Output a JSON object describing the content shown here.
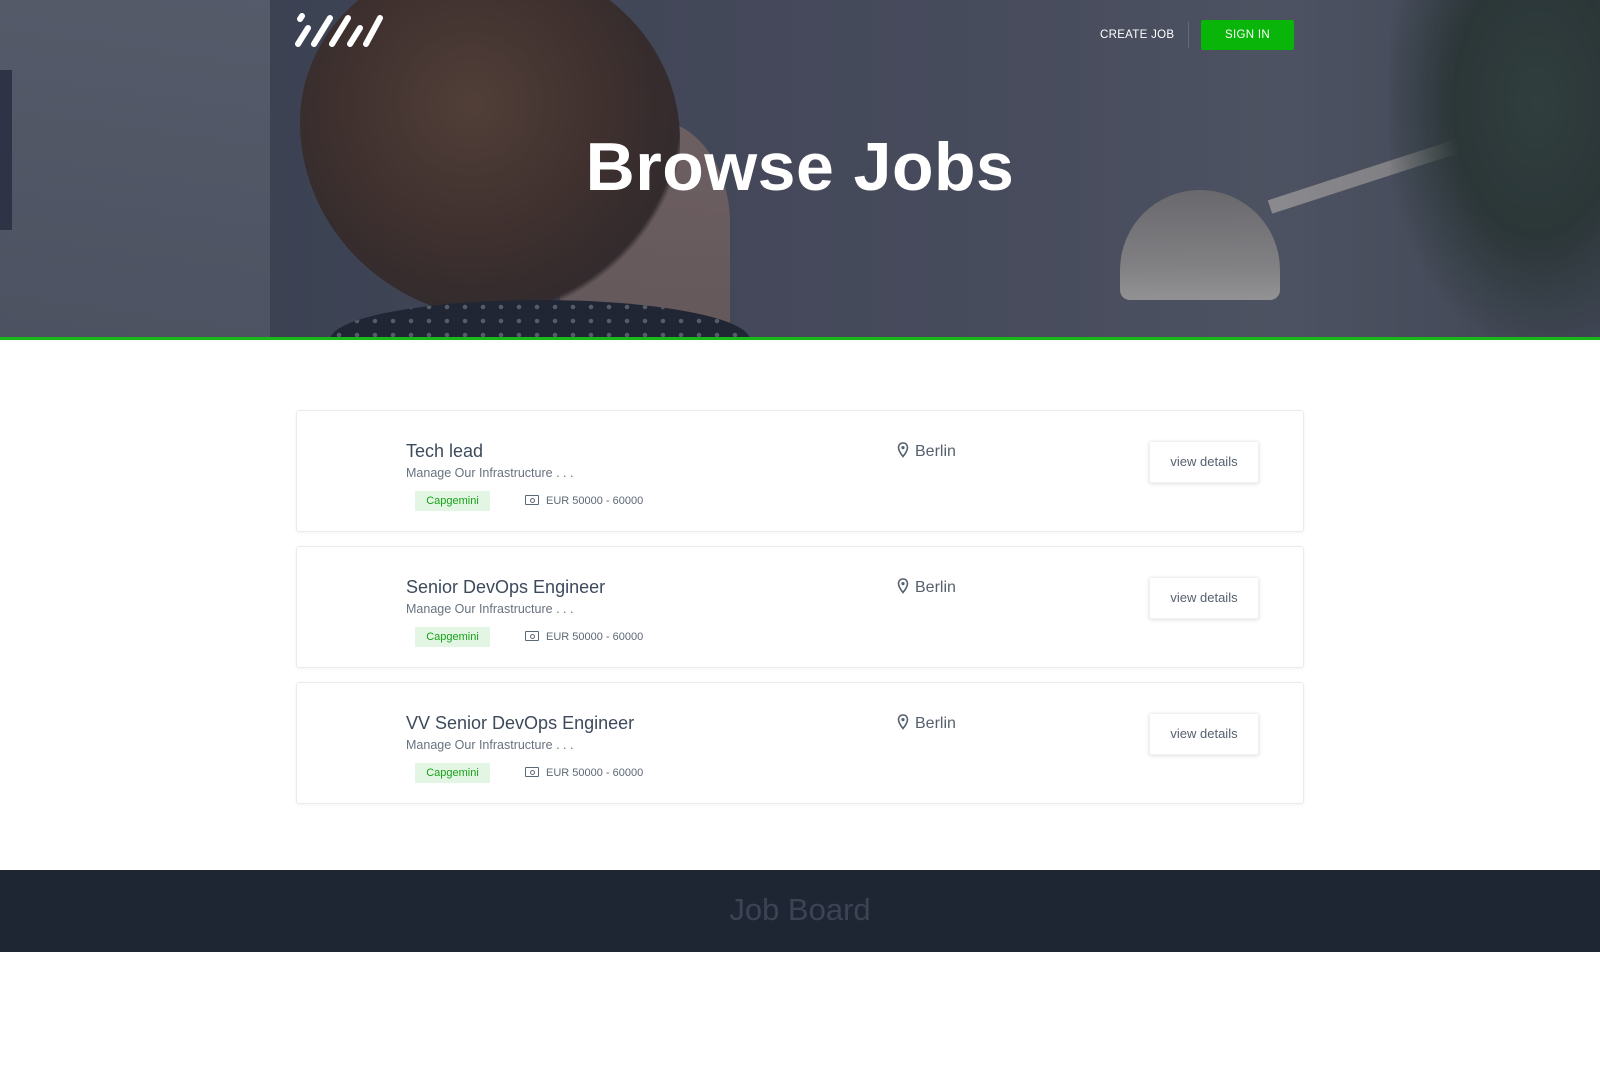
{
  "header": {
    "logo_alt": "logo",
    "nav": {
      "create_job": "CREATE JOB",
      "sign_in": "SIGN IN"
    },
    "title": "Browse Jobs",
    "accent_color": "#09b509"
  },
  "jobs": [
    {
      "title": "Tech lead",
      "description": "Manage Our Infrastructure . . .",
      "company": "Capgemini",
      "salary": "EUR 50000 - 60000",
      "location": "Berlin",
      "action": "view details"
    },
    {
      "title": "Senior DevOps Engineer",
      "description": "Manage Our Infrastructure . . .",
      "company": "Capgemini",
      "salary": "EUR 50000 - 60000",
      "location": "Berlin",
      "action": "view details"
    },
    {
      "title": "VV Senior DevOps Engineer",
      "description": "Manage Our Infrastructure . . .",
      "company": "Capgemini",
      "salary": "EUR 50000 - 60000",
      "location": "Berlin",
      "action": "view details"
    }
  ],
  "footer": {
    "title": "Job Board"
  },
  "icons": {
    "location": "map-pin-icon",
    "salary": "money-icon"
  }
}
